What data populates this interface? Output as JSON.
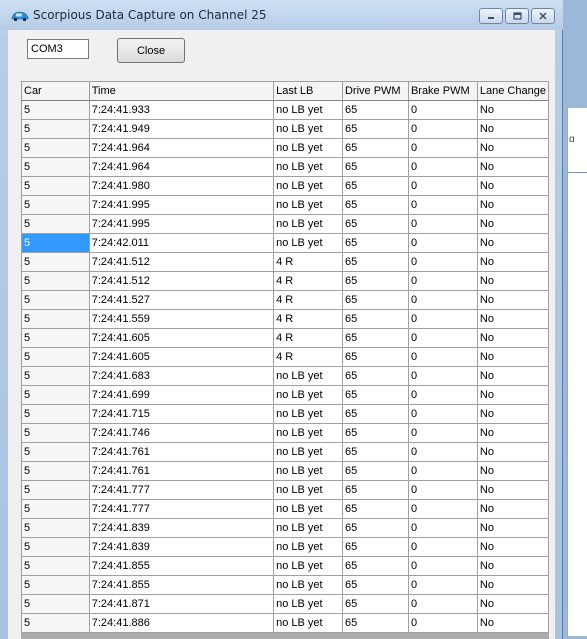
{
  "window": {
    "title": "Scorpious Data Capture on Channel 25",
    "icon": "car-icon"
  },
  "controls": {
    "port_value": "COM3",
    "close_label": "Close"
  },
  "desktop": {
    "fragment": "ɑ"
  },
  "colors": {
    "selection": "#3399ff",
    "titlebar": "#b9cfe9"
  },
  "grid": {
    "columns": [
      "Car",
      "Time",
      "Last LB",
      "Drive PWM",
      "Brake PWM",
      "Lane Change"
    ],
    "selected_row": 7,
    "rows": [
      [
        "5",
        "7:24:41.933",
        "no LB yet",
        "65",
        "0",
        "No"
      ],
      [
        "5",
        "7:24:41.949",
        "no LB yet",
        "65",
        "0",
        "No"
      ],
      [
        "5",
        "7:24:41.964",
        "no LB yet",
        "65",
        "0",
        "No"
      ],
      [
        "5",
        "7:24:41.964",
        "no LB yet",
        "65",
        "0",
        "No"
      ],
      [
        "5",
        "7:24:41.980",
        "no LB yet",
        "65",
        "0",
        "No"
      ],
      [
        "5",
        "7:24:41.995",
        "no LB yet",
        "65",
        "0",
        "No"
      ],
      [
        "5",
        "7:24:41.995",
        "no LB yet",
        "65",
        "0",
        "No"
      ],
      [
        "5",
        "7:24:42.011",
        "no LB yet",
        "65",
        "0",
        "No"
      ],
      [
        "5",
        "7:24:41.512",
        "4 R",
        "65",
        "0",
        "No"
      ],
      [
        "5",
        "7:24:41.512",
        "4 R",
        "65",
        "0",
        "No"
      ],
      [
        "5",
        "7:24:41.527",
        "4 R",
        "65",
        "0",
        "No"
      ],
      [
        "5",
        "7:24:41.559",
        "4 R",
        "65",
        "0",
        "No"
      ],
      [
        "5",
        "7:24:41.605",
        "4 R",
        "65",
        "0",
        "No"
      ],
      [
        "5",
        "7:24:41.605",
        "4 R",
        "65",
        "0",
        "No"
      ],
      [
        "5",
        "7:24:41.683",
        "no LB yet",
        "65",
        "0",
        "No"
      ],
      [
        "5",
        "7:24:41.699",
        "no LB yet",
        "65",
        "0",
        "No"
      ],
      [
        "5",
        "7:24:41.715",
        "no LB yet",
        "65",
        "0",
        "No"
      ],
      [
        "5",
        "7:24:41.746",
        "no LB yet",
        "65",
        "0",
        "No"
      ],
      [
        "5",
        "7:24:41.761",
        "no LB yet",
        "65",
        "0",
        "No"
      ],
      [
        "5",
        "7:24:41.761",
        "no LB yet",
        "65",
        "0",
        "No"
      ],
      [
        "5",
        "7:24:41.777",
        "no LB yet",
        "65",
        "0",
        "No"
      ],
      [
        "5",
        "7:24:41.777",
        "no LB yet",
        "65",
        "0",
        "No"
      ],
      [
        "5",
        "7:24:41.839",
        "no LB yet",
        "65",
        "0",
        "No"
      ],
      [
        "5",
        "7:24:41.839",
        "no LB yet",
        "65",
        "0",
        "No"
      ],
      [
        "5",
        "7:24:41.855",
        "no LB yet",
        "65",
        "0",
        "No"
      ],
      [
        "5",
        "7:24:41.855",
        "no LB yet",
        "65",
        "0",
        "No"
      ],
      [
        "5",
        "7:24:41.871",
        "no LB yet",
        "65",
        "0",
        "No"
      ],
      [
        "5",
        "7:24:41.886",
        "no LB yet",
        "65",
        "0",
        "No"
      ]
    ]
  }
}
